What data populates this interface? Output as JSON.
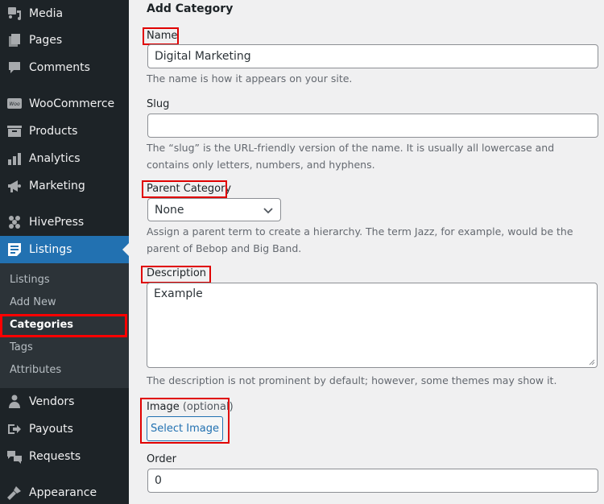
{
  "sidebar": {
    "items": [
      {
        "label": "Media",
        "icon": "media-icon"
      },
      {
        "label": "Pages",
        "icon": "pages-icon"
      },
      {
        "label": "Comments",
        "icon": "comments-icon"
      },
      {
        "label": "WooCommerce",
        "icon": "woocommerce-icon"
      },
      {
        "label": "Products",
        "icon": "products-icon"
      },
      {
        "label": "Analytics",
        "icon": "analytics-icon"
      },
      {
        "label": "Marketing",
        "icon": "marketing-icon"
      },
      {
        "label": "HivePress",
        "icon": "hivepress-icon"
      },
      {
        "label": "Listings",
        "icon": "listings-icon",
        "active": true
      },
      {
        "label": "Vendors",
        "icon": "vendors-icon"
      },
      {
        "label": "Payouts",
        "icon": "payouts-icon"
      },
      {
        "label": "Requests",
        "icon": "requests-icon"
      },
      {
        "label": "Appearance",
        "icon": "appearance-icon"
      }
    ],
    "submenu": [
      {
        "label": "Listings"
      },
      {
        "label": "Add New"
      },
      {
        "label": "Categories",
        "current": true
      },
      {
        "label": "Tags"
      },
      {
        "label": "Attributes"
      }
    ]
  },
  "form": {
    "title": "Add Category",
    "name": {
      "label": "Name",
      "value": "Digital Marketing",
      "help": "The name is how it appears on your site."
    },
    "slug": {
      "label": "Slug",
      "value": "",
      "help": "The “slug” is the URL-friendly version of the name. It is usually all lowercase and contains only letters, numbers, and hyphens."
    },
    "parent": {
      "label": "Parent Category",
      "selected": "None",
      "help": "Assign a parent term to create a hierarchy. The term Jazz, for example, would be the parent of Bebop and Big Band."
    },
    "description": {
      "label": "Description",
      "value": "Example",
      "help": "The description is not prominent by default; however, some themes may show it."
    },
    "image": {
      "label": "Image",
      "optional": "(optional)",
      "button": "Select Image"
    },
    "order": {
      "label": "Order",
      "value": "0"
    }
  },
  "colors": {
    "accent": "#2271b1",
    "highlight": "#ff0000",
    "sidebar_bg": "#1d2327",
    "submenu_bg": "#2c3338"
  }
}
